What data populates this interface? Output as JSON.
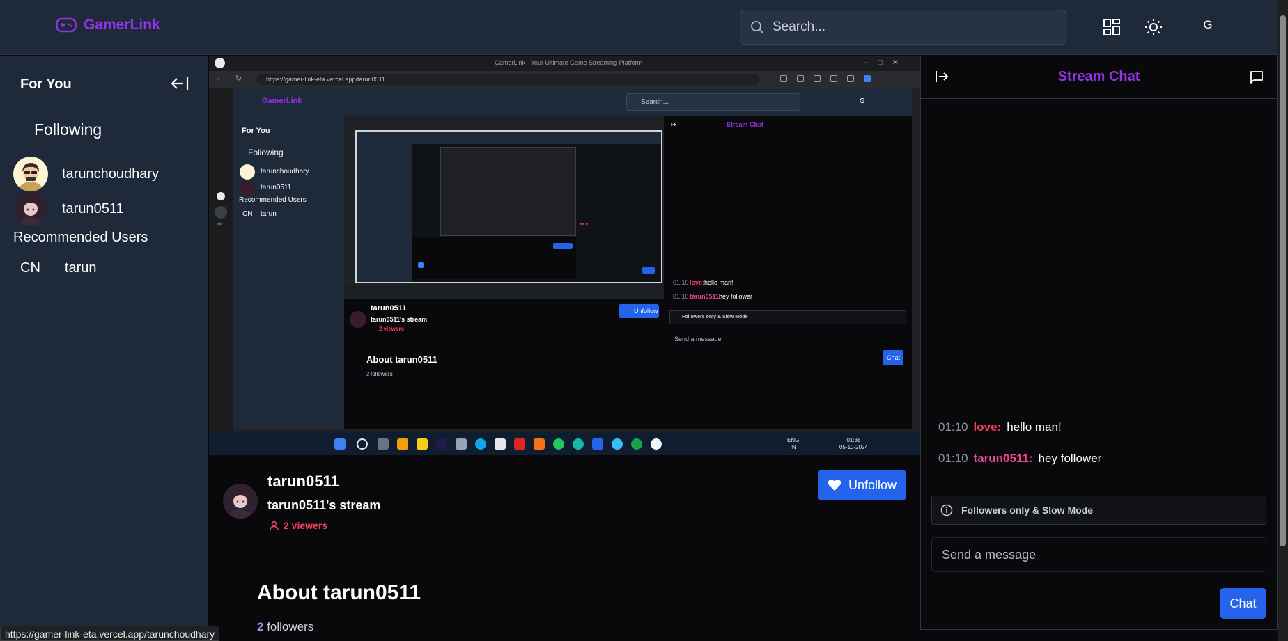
{
  "app": {
    "name": "GamerLink",
    "brand_color": "#9333ea"
  },
  "header": {
    "search_placeholder": "Search...",
    "avatar_initial": "G"
  },
  "sidebar": {
    "title": "For You",
    "following_label": "Following",
    "following": [
      {
        "name": "tarunchoudhary"
      },
      {
        "name": "tarun0511"
      }
    ],
    "recommended_label": "Recommended Users",
    "recommended": [
      {
        "initials": "CN",
        "name": "tarun"
      }
    ]
  },
  "video": {
    "browser_tab_title": "GamerLink - Your Ultimate Game Streaming Platform",
    "browser_url": "https://gamer-link-eta.vercel.app/tarun0511",
    "inner": {
      "logo": "GamerLink",
      "search_placeholder": "Search...",
      "avatar_initial": "G",
      "sidebar_title": "For You",
      "following_label": "Following",
      "following": [
        "tarunchoudhary",
        "tarun0511"
      ],
      "recommended_label": "Recommended Users",
      "recommended_initials": "CN",
      "recommended_name": "tarun",
      "streamer": "tarun0511",
      "stream_title": "tarun0511's stream",
      "viewers": "2 viewers",
      "unfollow_label": "Unfollow",
      "about": "About tarun0511",
      "followers_count": "2",
      "followers_label": "followers",
      "chat_title": "Stream Chat",
      "messages": [
        {
          "time": "01:10",
          "user": "love:",
          "text": "hello man!"
        },
        {
          "time": "01:10",
          "user": "tarun0511:",
          "text": "hey follower"
        }
      ],
      "mode": "Followers only & Slow Mode",
      "input_placeholder": "Send a message",
      "chat_button": "Chat"
    },
    "taskbar": {
      "lang": "ENG",
      "region": "IN",
      "time": "01:38",
      "date": "05-10-2024"
    }
  },
  "stream": {
    "streamer": "tarun0511",
    "title": "tarun0511's stream",
    "viewers": "2 viewers",
    "unfollow_label": "Unfollow",
    "about": "About tarun0511",
    "followers_count": "2",
    "followers_label": "followers"
  },
  "chat": {
    "title": "Stream Chat",
    "messages": [
      {
        "time": "01:10",
        "user": "love:",
        "text": "hello man!",
        "user_color": "#f43f5e"
      },
      {
        "time": "01:10",
        "user": "tarun0511:",
        "text": "hey follower",
        "user_color": "#ec4899"
      }
    ],
    "mode": "Followers only & Slow Mode",
    "input_placeholder": "Send a message",
    "send_button": "Chat"
  },
  "status_url": "https://gamer-link-eta.vercel.app/tarunchoudhary"
}
